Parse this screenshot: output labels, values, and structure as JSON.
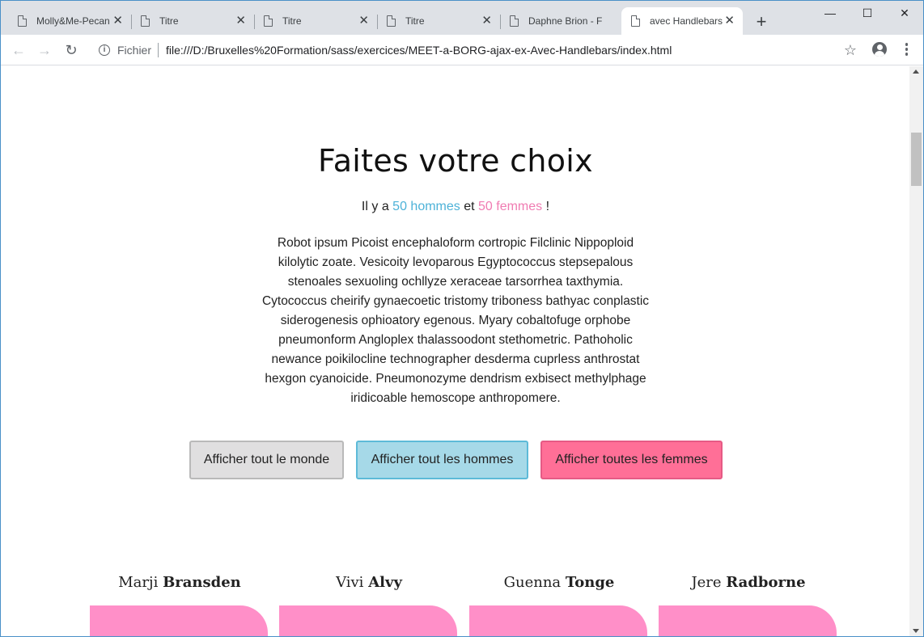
{
  "browser": {
    "tabs": [
      {
        "label": "Molly&Me-Pecan"
      },
      {
        "label": "Titre"
      },
      {
        "label": "Titre"
      },
      {
        "label": "Titre"
      },
      {
        "label": "Daphne Brion - F"
      },
      {
        "label": "avec Handlebars"
      }
    ],
    "active_tab_index": 5,
    "close_glyph": "✕",
    "new_tab_glyph": "+",
    "window_controls": {
      "minimize": "—",
      "maximize": "☐",
      "close": "✕"
    },
    "nav": {
      "back": "←",
      "forward": "→",
      "reload": "↻"
    },
    "address": {
      "scheme_label": "Fichier",
      "url": "file:///D:/Bruxelles%20Formation/sass/exercices/MEET-a-BORG-ajax-ex-Avec-Handlebars/index.html"
    },
    "bookmark_glyph": "☆"
  },
  "page": {
    "title": "Faites votre choix",
    "counts": {
      "prefix": "Il y a",
      "men": "50 hommes",
      "conjunction": "et",
      "women": "50 femmes",
      "suffix": "!"
    },
    "lorem_lines": [
      "Robot ipsum Picoist encephaloform cortropic Filclinic Nippoploid",
      "kilolytic zoate. Vesicoity levoparous Egyptococcus stepsepalous",
      "stenoales sexuoling ochllyze xeraceae tarsorrhea taxthymia.",
      "Cytococcus cheirify gynaecoetic tristomy triboness bathyac conplastic",
      "siderogenesis ophioatory egenous. Myary cobaltofuge orphobe",
      "pneumonform Angloplex thalassoodont stethometric. Pathoholic",
      "newance poikilocline technographer desderma cuprless anthrostat",
      "hexgon cyanoicide. Pneumonozyme dendrism exbisect methylphage",
      "iridicoable hemoscope anthropomere."
    ],
    "buttons": {
      "all": "Afficher tout le monde",
      "men": "Afficher tout les hommes",
      "women": "Afficher toutes les femmes"
    },
    "people": [
      {
        "first": "Marji",
        "last": "Bransden"
      },
      {
        "first": "Vivi",
        "last": "Alvy"
      },
      {
        "first": "Guenna",
        "last": "Tonge"
      },
      {
        "first": "Jere",
        "last": "Radborne"
      }
    ],
    "colors": {
      "men_accent": "#4db2d8",
      "women_accent": "#f07cb2",
      "card_pink": "#ff8fc8",
      "button_women": "#ff6f97",
      "button_men": "#a6d9e8",
      "button_all": "#e0dfe0"
    }
  }
}
